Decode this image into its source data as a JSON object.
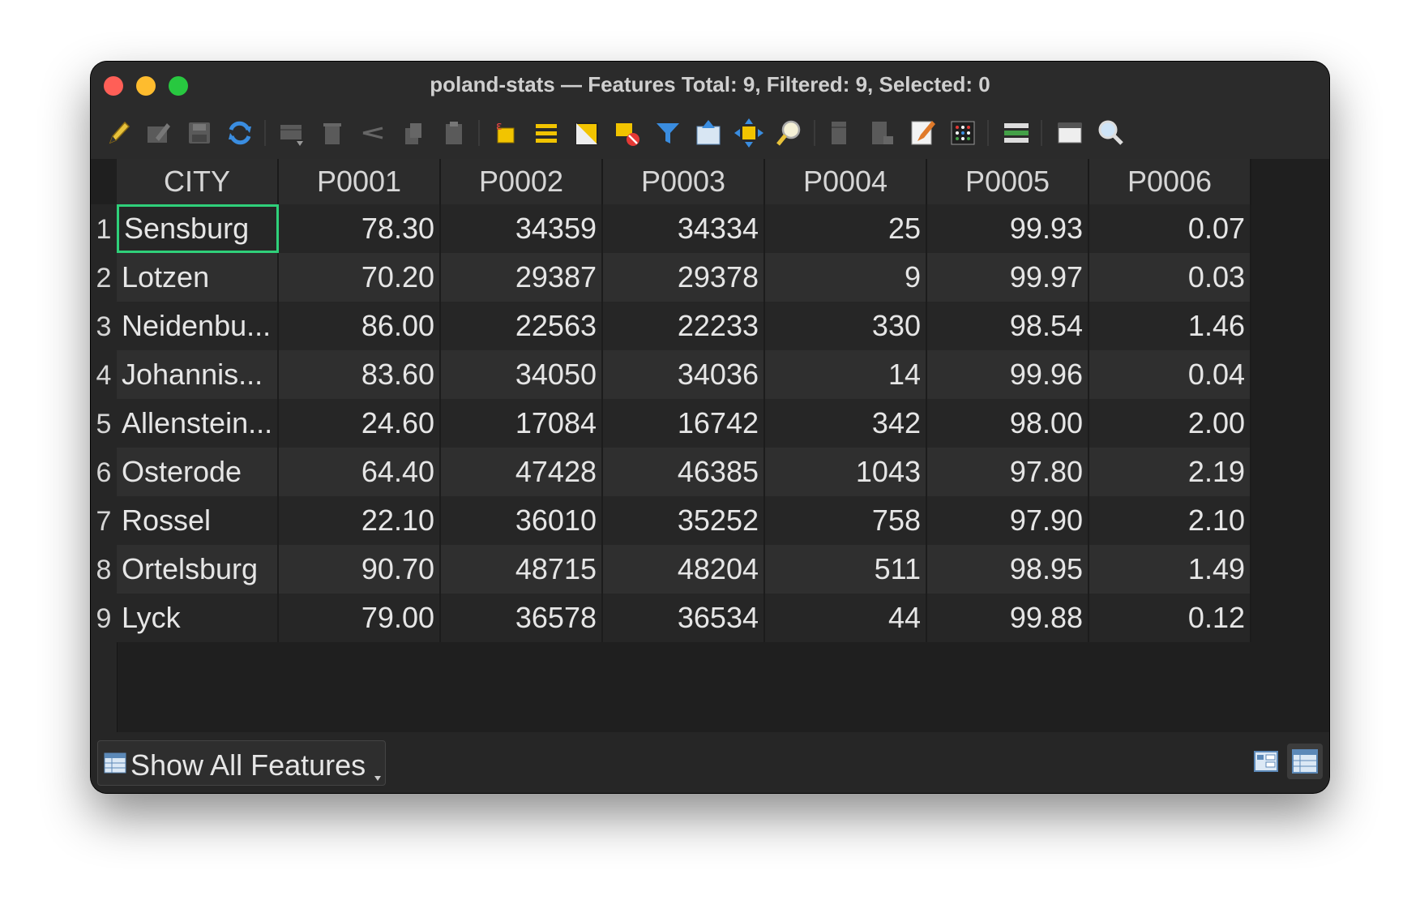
{
  "window": {
    "title": "poland-stats — Features Total: 9, Filtered: 9, Selected: 0"
  },
  "toolbar": {
    "icons": [
      "toggle-editing-icon",
      "multi-edit-icon",
      "save-edits-icon",
      "reload-icon",
      "add-feature-icon",
      "delete-feature-icon",
      "cut-icon",
      "copy-icon",
      "paste-icon",
      "select-by-expression-icon",
      "select-all-icon",
      "invert-selection-icon",
      "deselect-all-icon",
      "filter-select-icon",
      "move-selection-top-icon",
      "pan-to-selection-icon",
      "zoom-to-selection-icon",
      "new-field-icon",
      "delete-field-icon",
      "field-calculator-icon",
      "conditional-formatting-icon",
      "actions-icon",
      "dock-table-icon",
      "search-icon"
    ]
  },
  "table": {
    "columns": [
      "CITY",
      "P0001",
      "P0002",
      "P0003",
      "P0004",
      "P0005",
      "P0006"
    ],
    "rows": [
      {
        "num": "1",
        "cells": [
          "Sensburg",
          "78.30",
          "34359",
          "34334",
          "25",
          "99.93",
          "0.07"
        ]
      },
      {
        "num": "2",
        "cells": [
          "Lotzen",
          "70.20",
          "29387",
          "29378",
          "9",
          "99.97",
          "0.03"
        ]
      },
      {
        "num": "3",
        "cells": [
          "Neidenbu...",
          "86.00",
          "22563",
          "22233",
          "330",
          "98.54",
          "1.46"
        ]
      },
      {
        "num": "4",
        "cells": [
          "Johannis...",
          "83.60",
          "34050",
          "34036",
          "14",
          "99.96",
          "0.04"
        ]
      },
      {
        "num": "5",
        "cells": [
          "Allenstein...",
          "24.60",
          "17084",
          "16742",
          "342",
          "98.00",
          "2.00"
        ]
      },
      {
        "num": "6",
        "cells": [
          "Osterode",
          "64.40",
          "47428",
          "46385",
          "1043",
          "97.80",
          "2.19"
        ]
      },
      {
        "num": "7",
        "cells": [
          "Rossel",
          "22.10",
          "36010",
          "35252",
          "758",
          "97.90",
          "2.10"
        ]
      },
      {
        "num": "8",
        "cells": [
          "Ortelsburg",
          "90.70",
          "48715",
          "48204",
          "511",
          "98.95",
          "1.49"
        ]
      },
      {
        "num": "9",
        "cells": [
          "Lyck",
          "79.00",
          "36578",
          "36534",
          "44",
          "99.88",
          "0.12"
        ]
      }
    ]
  },
  "footer": {
    "filter_label": "Show All Features",
    "filter_icon": "table-icon",
    "view_modes": [
      "form-view-icon",
      "table-view-icon"
    ]
  }
}
